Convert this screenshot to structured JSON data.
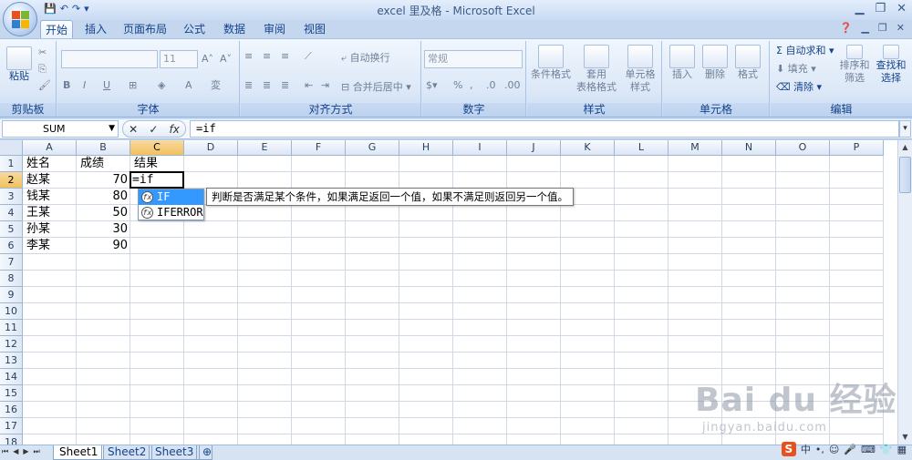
{
  "window": {
    "title": "excel 里及格 - Microsoft Excel"
  },
  "ribbon_tabs": [
    "开始",
    "插入",
    "页面布局",
    "公式",
    "数据",
    "审阅",
    "视图"
  ],
  "ribbon": {
    "clipboard": {
      "label": "剪贴板",
      "paste": "粘贴"
    },
    "font": {
      "label": "字体",
      "size": "11",
      "bold": "B",
      "italic": "I",
      "underline": "U"
    },
    "alignment": {
      "label": "对齐方式",
      "wrap": "自动换行",
      "merge": "合并后居中"
    },
    "number": {
      "label": "数字",
      "format": "常规"
    },
    "styles": {
      "label": "样式",
      "conditional": "条件格式",
      "table_format_1": "套用",
      "table_format_2": "表格格式",
      "cell_style_1": "单元格",
      "cell_style_2": "样式"
    },
    "cells": {
      "label": "单元格",
      "insert": "插入",
      "delete": "删除",
      "format": "格式"
    },
    "editing": {
      "label": "编辑",
      "autosum": "自动求和",
      "fill": "填充",
      "clear": "清除",
      "sort_1": "排序和",
      "sort_2": "筛选",
      "find_1": "查找和",
      "find_2": "选择"
    }
  },
  "formula_bar": {
    "name_box": "SUM",
    "formula": "=if"
  },
  "columns": [
    "A",
    "B",
    "C",
    "D",
    "E",
    "F",
    "G",
    "H",
    "I",
    "J",
    "K",
    "L",
    "M",
    "N",
    "O",
    "P"
  ],
  "rows": [
    "1",
    "2",
    "3",
    "4",
    "5",
    "6",
    "7",
    "8",
    "9",
    "10",
    "11",
    "12",
    "13",
    "14",
    "15",
    "16",
    "17",
    "18"
  ],
  "cells": {
    "A1": "姓名",
    "B1": "成绩",
    "C1": "结果",
    "A2": "赵某",
    "B2": "70",
    "C2": "=if",
    "A3": "钱某",
    "B3": "80",
    "A4": "王某",
    "B4": "50",
    "A5": "孙某",
    "B5": "30",
    "A6": "李某",
    "B6": "90"
  },
  "autocomplete": {
    "items": [
      "IF",
      "IFERROR"
    ],
    "tooltip": "判断是否满足某个条件，如果满足返回一个值，如果不满足则返回另一个值。"
  },
  "sheet_tabs": [
    "Sheet1",
    "Sheet2",
    "Sheet3"
  ],
  "ime": {
    "lang": "中"
  },
  "watermark": {
    "brand": "Bai du 经验",
    "url": "jingyan.baidu.com"
  },
  "colors": {
    "accent": "#15428b",
    "selected_header": "#f1c15f",
    "highlight": "#3399ff"
  }
}
